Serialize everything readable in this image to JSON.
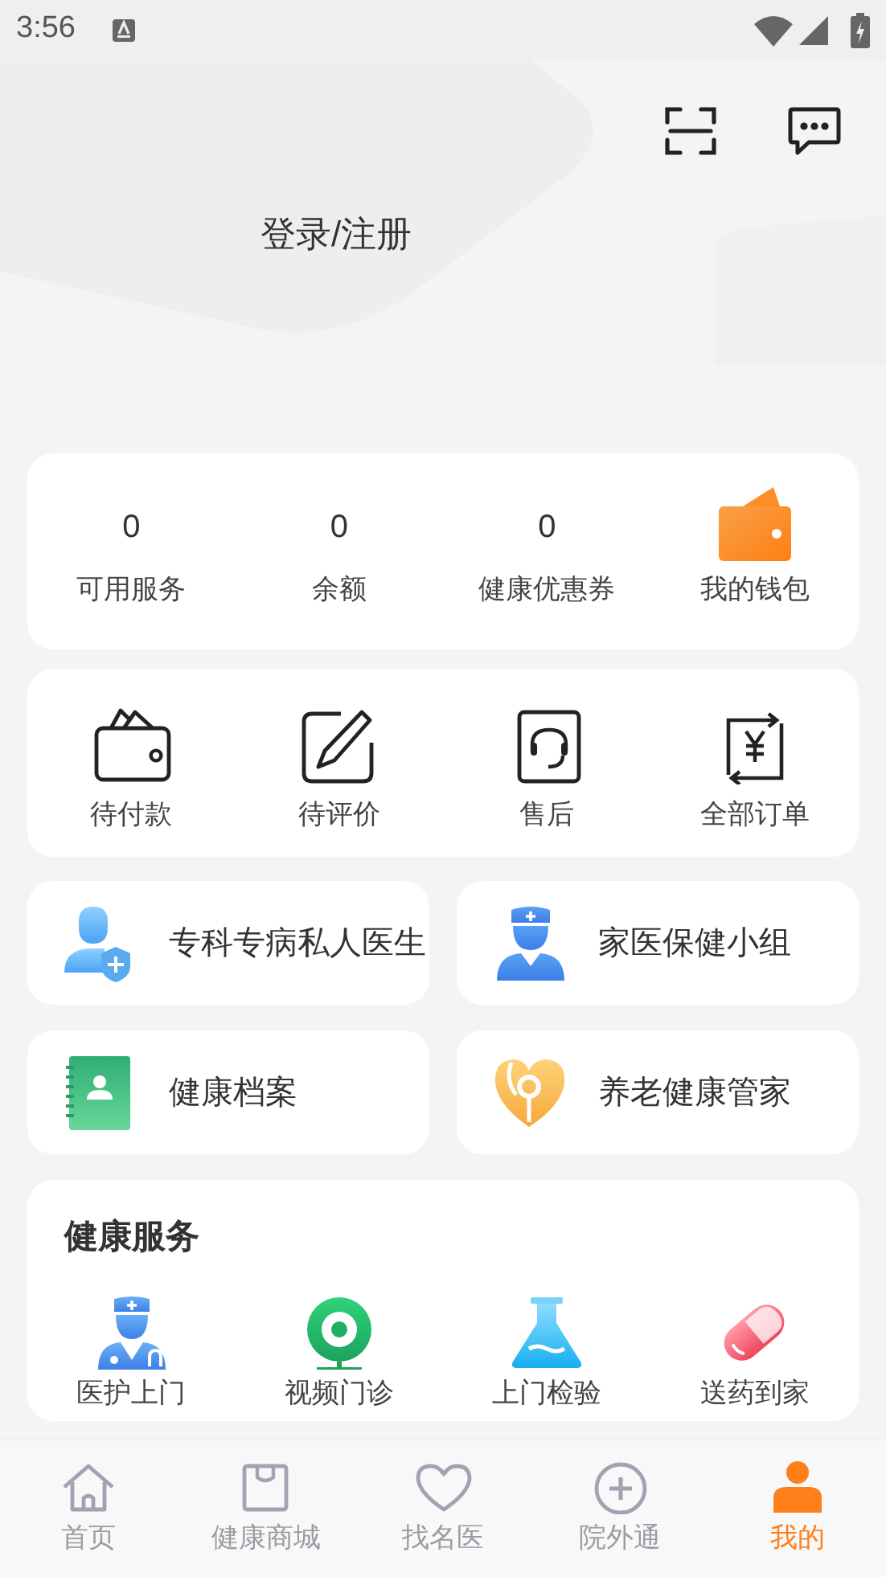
{
  "status_bar": {
    "time": "3:56"
  },
  "header": {
    "login": "登录/注册"
  },
  "stats": [
    {
      "value": "0",
      "label": "可用服务"
    },
    {
      "value": "0",
      "label": "余额"
    },
    {
      "value": "0",
      "label": "健康优惠券"
    }
  ],
  "wallet": {
    "label": "我的钱包"
  },
  "orders": [
    {
      "label": "待付款"
    },
    {
      "label": "待评价"
    },
    {
      "label": "售后"
    },
    {
      "label": "全部订单"
    }
  ],
  "tiles": [
    {
      "label": "专科专病私人医生"
    },
    {
      "label": "家医保健小组"
    },
    {
      "label": "健康档案"
    },
    {
      "label": "养老健康管家"
    }
  ],
  "health_services": {
    "title": "健康服务",
    "items": [
      {
        "label": "医护上门"
      },
      {
        "label": "视频门诊"
      },
      {
        "label": "上门检验"
      },
      {
        "label": "送药到家"
      }
    ]
  },
  "tabs": [
    {
      "label": "首页",
      "selected": false
    },
    {
      "label": "健康商城",
      "selected": false
    },
    {
      "label": "找名医",
      "selected": false
    },
    {
      "label": "院外通",
      "selected": false
    },
    {
      "label": "我的",
      "selected": true
    }
  ]
}
